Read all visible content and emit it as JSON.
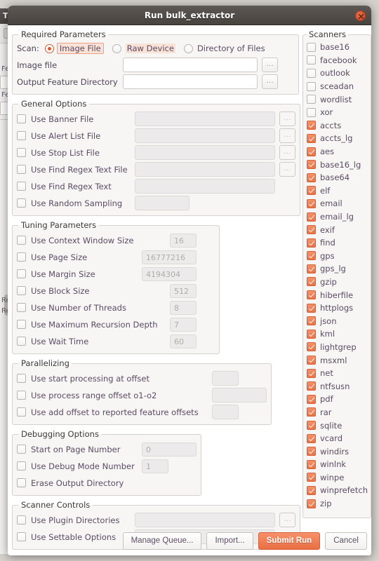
{
  "background_app": {
    "title": "T",
    "labels": [
      "Fe",
      "Fe",
      "Re",
      "Re"
    ]
  },
  "window": {
    "title": "Run bulk_extractor",
    "close_icon": "close-icon"
  },
  "required_parameters": {
    "legend": "Required Parameters",
    "scan_label": "Scan:",
    "scan_options": [
      {
        "label": "Image File",
        "selected": true,
        "focused": true
      },
      {
        "label": "Raw Device",
        "selected": false,
        "highlighted": true
      },
      {
        "label": "Directory of Files",
        "selected": false
      }
    ],
    "fields": [
      {
        "label": "Image file",
        "value": "",
        "enabled": true,
        "browse": "..."
      },
      {
        "label": "Output Feature Directory",
        "value": "",
        "enabled": true,
        "browse": "..."
      }
    ]
  },
  "general_options": {
    "legend": "General Options",
    "rows": [
      {
        "label": "Use Banner File",
        "checked": false,
        "value": "",
        "has_input": true,
        "has_browse": true,
        "input_w": 200
      },
      {
        "label": "Use Alert List File",
        "checked": false,
        "value": "",
        "has_input": true,
        "has_browse": true,
        "input_w": 200
      },
      {
        "label": "Use Stop List File",
        "checked": false,
        "value": "",
        "has_input": true,
        "has_browse": true,
        "input_w": 200
      },
      {
        "label": "Use Find Regex Text File",
        "checked": false,
        "value": "",
        "has_input": true,
        "has_browse": true,
        "input_w": 200
      },
      {
        "label": "Use Find Regex Text",
        "checked": false,
        "value": "",
        "has_input": true,
        "has_browse": false,
        "input_w": 200
      },
      {
        "label": "Use Random Sampling",
        "checked": false,
        "value": "",
        "has_input": true,
        "has_browse": false,
        "input_w": 78
      }
    ]
  },
  "tuning_parameters": {
    "legend": "Tuning Parameters",
    "rows": [
      {
        "label": "Use Context Window Size",
        "checked": false,
        "value": "16",
        "input_w": 38
      },
      {
        "label": "Use Page Size",
        "checked": false,
        "value": "16777216",
        "input_w": 78
      },
      {
        "label": "Use Margin Size",
        "checked": false,
        "value": "4194304",
        "input_w": 78
      },
      {
        "label": "Use Block Size",
        "checked": false,
        "value": "512",
        "input_w": 38
      },
      {
        "label": "Use Number of Threads",
        "checked": false,
        "value": "8",
        "input_w": 38
      },
      {
        "label": "Use Maximum Recursion Depth",
        "checked": false,
        "value": "7",
        "input_w": 38
      },
      {
        "label": "Use Wait Time",
        "checked": false,
        "value": "60",
        "input_w": 38
      }
    ]
  },
  "parallelizing": {
    "legend": "Parallelizing",
    "rows": [
      {
        "label": "Use start processing at offset",
        "checked": false,
        "value": "",
        "input_w": 38
      },
      {
        "label": "Use process range offset o1-o2",
        "checked": false,
        "value": "",
        "input_w": 78
      },
      {
        "label": "Use add offset to reported feature offsets",
        "checked": false,
        "value": "",
        "input_w": 38
      }
    ]
  },
  "debugging_options": {
    "legend": "Debugging Options",
    "rows": [
      {
        "label": "Start on Page Number",
        "checked": false,
        "value": "0",
        "has_input": true,
        "input_w": 78
      },
      {
        "label": "Use Debug Mode Number",
        "checked": false,
        "value": "1",
        "has_input": true,
        "input_w": 38
      },
      {
        "label": "Erase Output Directory",
        "checked": false,
        "value": "",
        "has_input": false,
        "input_w": 0
      }
    ]
  },
  "scanner_controls": {
    "legend": "Scanner Controls",
    "rows": [
      {
        "label": "Use Plugin Directories",
        "checked": false,
        "value": "",
        "has_browse": true,
        "input_w": 200
      },
      {
        "label": "Use Settable Options",
        "checked": false,
        "value": "",
        "has_browse": false,
        "input_w": 200
      }
    ]
  },
  "scanners": {
    "legend": "Scanners",
    "items": [
      {
        "label": "base16",
        "checked": false
      },
      {
        "label": "facebook",
        "checked": false
      },
      {
        "label": "outlook",
        "checked": false
      },
      {
        "label": "sceadan",
        "checked": false
      },
      {
        "label": "wordlist",
        "checked": false
      },
      {
        "label": "xor",
        "checked": false
      },
      {
        "label": "accts",
        "checked": true
      },
      {
        "label": "accts_lg",
        "checked": true
      },
      {
        "label": "aes",
        "checked": true
      },
      {
        "label": "base16_lg",
        "checked": true
      },
      {
        "label": "base64",
        "checked": true
      },
      {
        "label": "elf",
        "checked": true
      },
      {
        "label": "email",
        "checked": true
      },
      {
        "label": "email_lg",
        "checked": true
      },
      {
        "label": "exif",
        "checked": true
      },
      {
        "label": "find",
        "checked": true
      },
      {
        "label": "gps",
        "checked": true
      },
      {
        "label": "gps_lg",
        "checked": true
      },
      {
        "label": "gzip",
        "checked": true
      },
      {
        "label": "hiberfile",
        "checked": true
      },
      {
        "label": "httplogs",
        "checked": true
      },
      {
        "label": "json",
        "checked": true
      },
      {
        "label": "kml",
        "checked": true
      },
      {
        "label": "lightgrep",
        "checked": true
      },
      {
        "label": "msxml",
        "checked": true
      },
      {
        "label": "net",
        "checked": true
      },
      {
        "label": "ntfsusn",
        "checked": true
      },
      {
        "label": "pdf",
        "checked": true
      },
      {
        "label": "rar",
        "checked": true
      },
      {
        "label": "sqlite",
        "checked": true
      },
      {
        "label": "vcard",
        "checked": true
      },
      {
        "label": "windirs",
        "checked": true
      },
      {
        "label": "winlnk",
        "checked": true
      },
      {
        "label": "winpe",
        "checked": true
      },
      {
        "label": "winprefetch",
        "checked": true
      },
      {
        "label": "zip",
        "checked": true
      }
    ]
  },
  "buttons": {
    "manage_queue": "Manage Queue...",
    "import": "Import...",
    "submit_run": "Submit Run",
    "cancel": "Cancel"
  },
  "colors": {
    "accent": "#ea7346",
    "titlebar": "#4f4a46",
    "label_text": "#5a4b63",
    "group_bg": "#f7f6f5"
  }
}
